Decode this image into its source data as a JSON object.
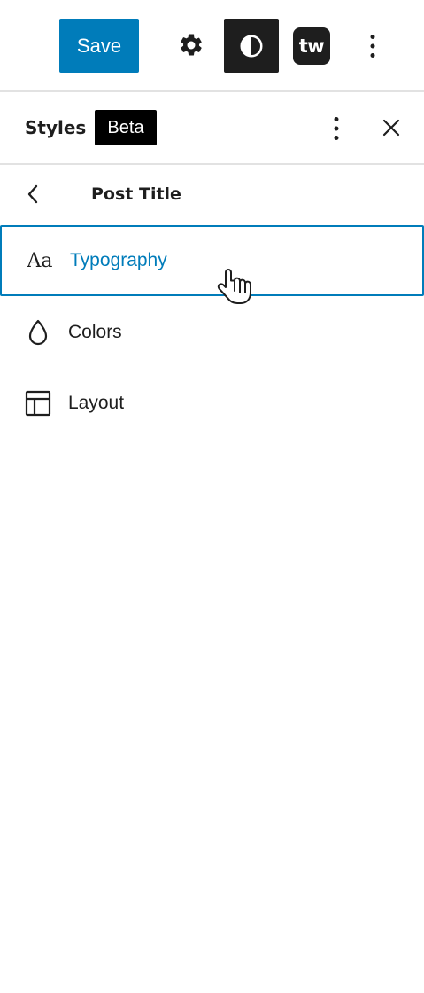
{
  "toolbar": {
    "save_label": "Save",
    "tw_label": "tw"
  },
  "panel": {
    "title": "Styles",
    "badge": "Beta"
  },
  "navigator": {
    "title": "Post Title"
  },
  "menu": {
    "items": [
      {
        "label": "Typography",
        "icon": "typography-icon",
        "icon_glyph": "Aa",
        "active": true
      },
      {
        "label": "Colors",
        "icon": "droplet-icon",
        "active": false
      },
      {
        "label": "Layout",
        "icon": "layout-icon",
        "active": false
      }
    ]
  },
  "colors": {
    "accent": "#007cba",
    "dark": "#1e1e1e",
    "divider": "#e2e2e2"
  }
}
